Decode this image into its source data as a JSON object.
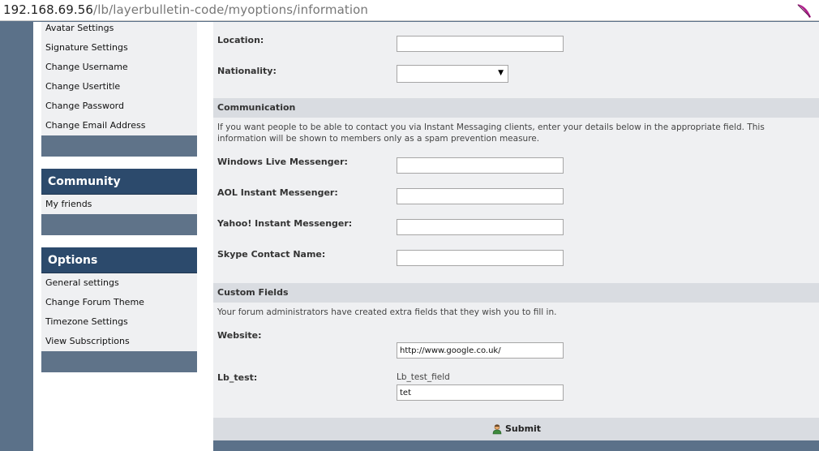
{
  "url": {
    "host": "192.168.69.56",
    "path": "/lb/layerbulletin-code/myoptions/information"
  },
  "sidebar": {
    "profile_items": [
      "Avatar Settings",
      "Signature Settings",
      "Change Username",
      "Change Usertitle",
      "Change Password",
      "Change Email Address"
    ],
    "community": {
      "title": "Community",
      "items": [
        "My friends"
      ]
    },
    "options": {
      "title": "Options",
      "items": [
        "General settings",
        "Change Forum Theme",
        "Timezone Settings",
        "View Subscriptions"
      ]
    }
  },
  "form": {
    "location": {
      "label": "Location:",
      "value": ""
    },
    "nationality": {
      "label": "Nationality:",
      "value": ""
    },
    "communication": {
      "title": "Communication",
      "description": "If you want people to be able to contact you via Instant Messaging clients, enter your details below in the appropriate field. This information will be shown to members only as a spam prevention measure.",
      "wlm": {
        "label": "Windows Live Messenger:",
        "value": ""
      },
      "aim": {
        "label": "AOL Instant Messenger:",
        "value": ""
      },
      "yahoo": {
        "label": "Yahoo! Instant Messenger:",
        "value": ""
      },
      "skype": {
        "label": "Skype Contact Name:",
        "value": ""
      }
    },
    "custom": {
      "title": "Custom Fields",
      "description": "Your forum administrators have created extra fields that they wish you to fill in.",
      "website": {
        "label": "Website:",
        "value": "http://www.google.co.uk/"
      },
      "lbtest": {
        "label": "Lb_test:",
        "hint": "Lb_test_field",
        "value": "tet"
      }
    },
    "submit_label": "Submit"
  },
  "colors": {
    "sidebar_header": "#2c4a6c",
    "frame": "#5b7189",
    "panel": "#eff0f2",
    "section": "#d9dce1"
  }
}
